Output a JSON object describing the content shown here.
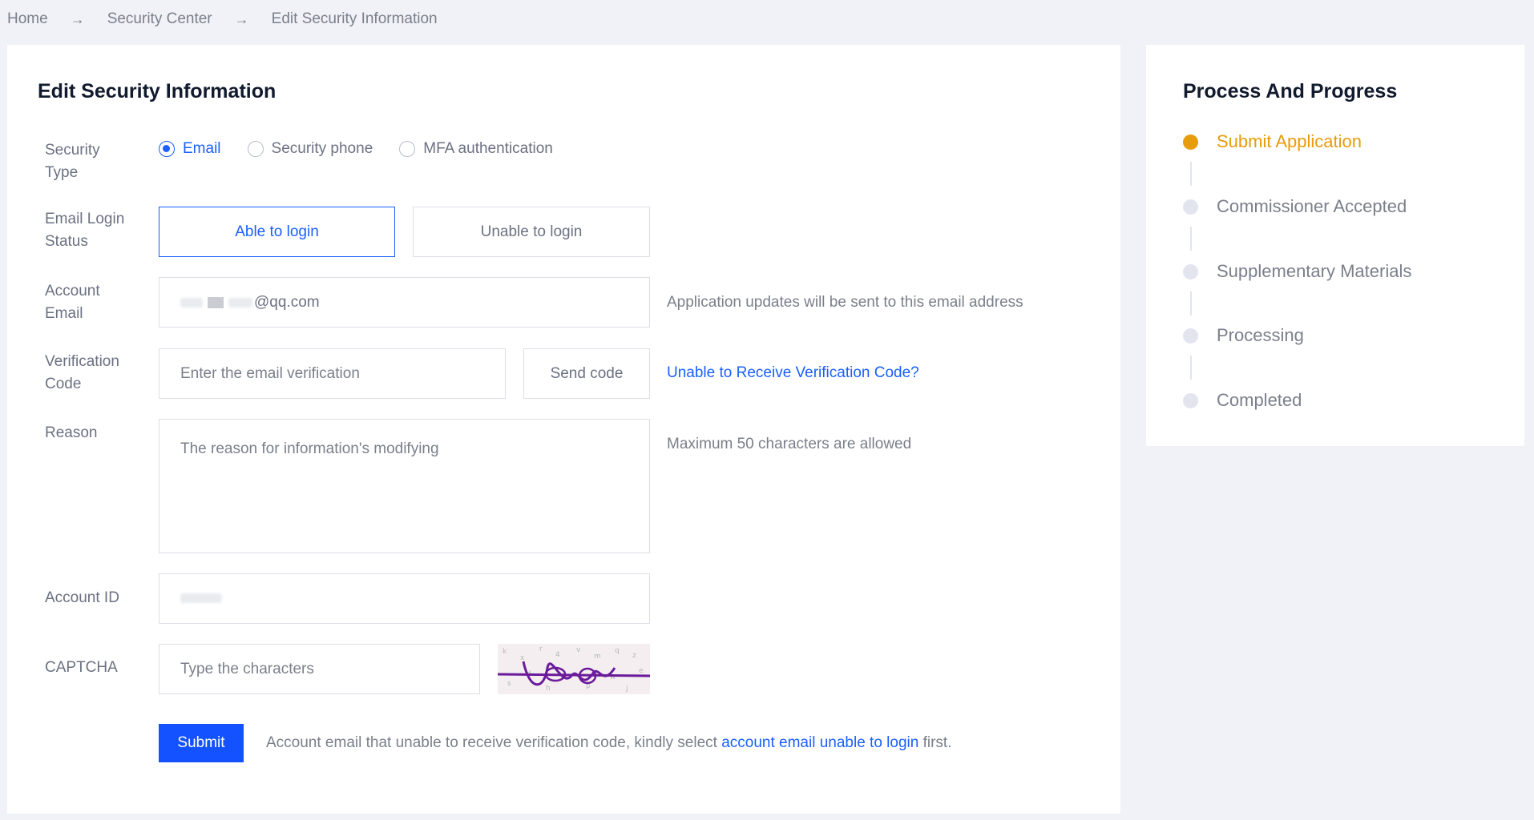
{
  "breadcrumb": {
    "items": [
      "Home",
      "Security Center",
      "Edit Security Information"
    ],
    "separator": "→"
  },
  "form": {
    "title": "Edit Security Information",
    "security_type": {
      "label": "Security Type",
      "options": [
        "Email",
        "Security phone",
        "MFA authentication"
      ],
      "selected": "Email"
    },
    "email_login_status": {
      "label": "Email Login Status",
      "options": [
        "Able to login",
        "Unable to login"
      ],
      "selected": "Able to login"
    },
    "account_email": {
      "label": "Account Email",
      "value_suffix": "@qq.com",
      "hint": "Application updates will be sent to this email address"
    },
    "verification_code": {
      "label": "Verification Code",
      "placeholder": "Enter the email verification",
      "send_button": "Send code",
      "help_link": "Unable to Receive Verification Code?"
    },
    "reason": {
      "label": "Reason",
      "placeholder": "The reason for information's modifying",
      "hint": "Maximum 50 characters are allowed"
    },
    "account_id": {
      "label": "Account ID"
    },
    "captcha": {
      "label": "CAPTCHA",
      "placeholder": "Type the characters"
    },
    "submit": {
      "button": "Submit",
      "note_before": "Account email that unable to receive verification code, kindly select ",
      "note_link": "account email unable to login",
      "note_after": " first."
    }
  },
  "progress": {
    "title": "Process And Progress",
    "steps": [
      {
        "label": "Submit Application",
        "status": "active"
      },
      {
        "label": "Commissioner Accepted",
        "status": "pending"
      },
      {
        "label": "Supplementary Materials",
        "status": "pending"
      },
      {
        "label": "Processing",
        "status": "pending"
      },
      {
        "label": "Completed",
        "status": "pending"
      }
    ]
  },
  "colors": {
    "accent": "#1a5fff",
    "active_step": "#e79c0b",
    "background": "#f0f2f7"
  }
}
